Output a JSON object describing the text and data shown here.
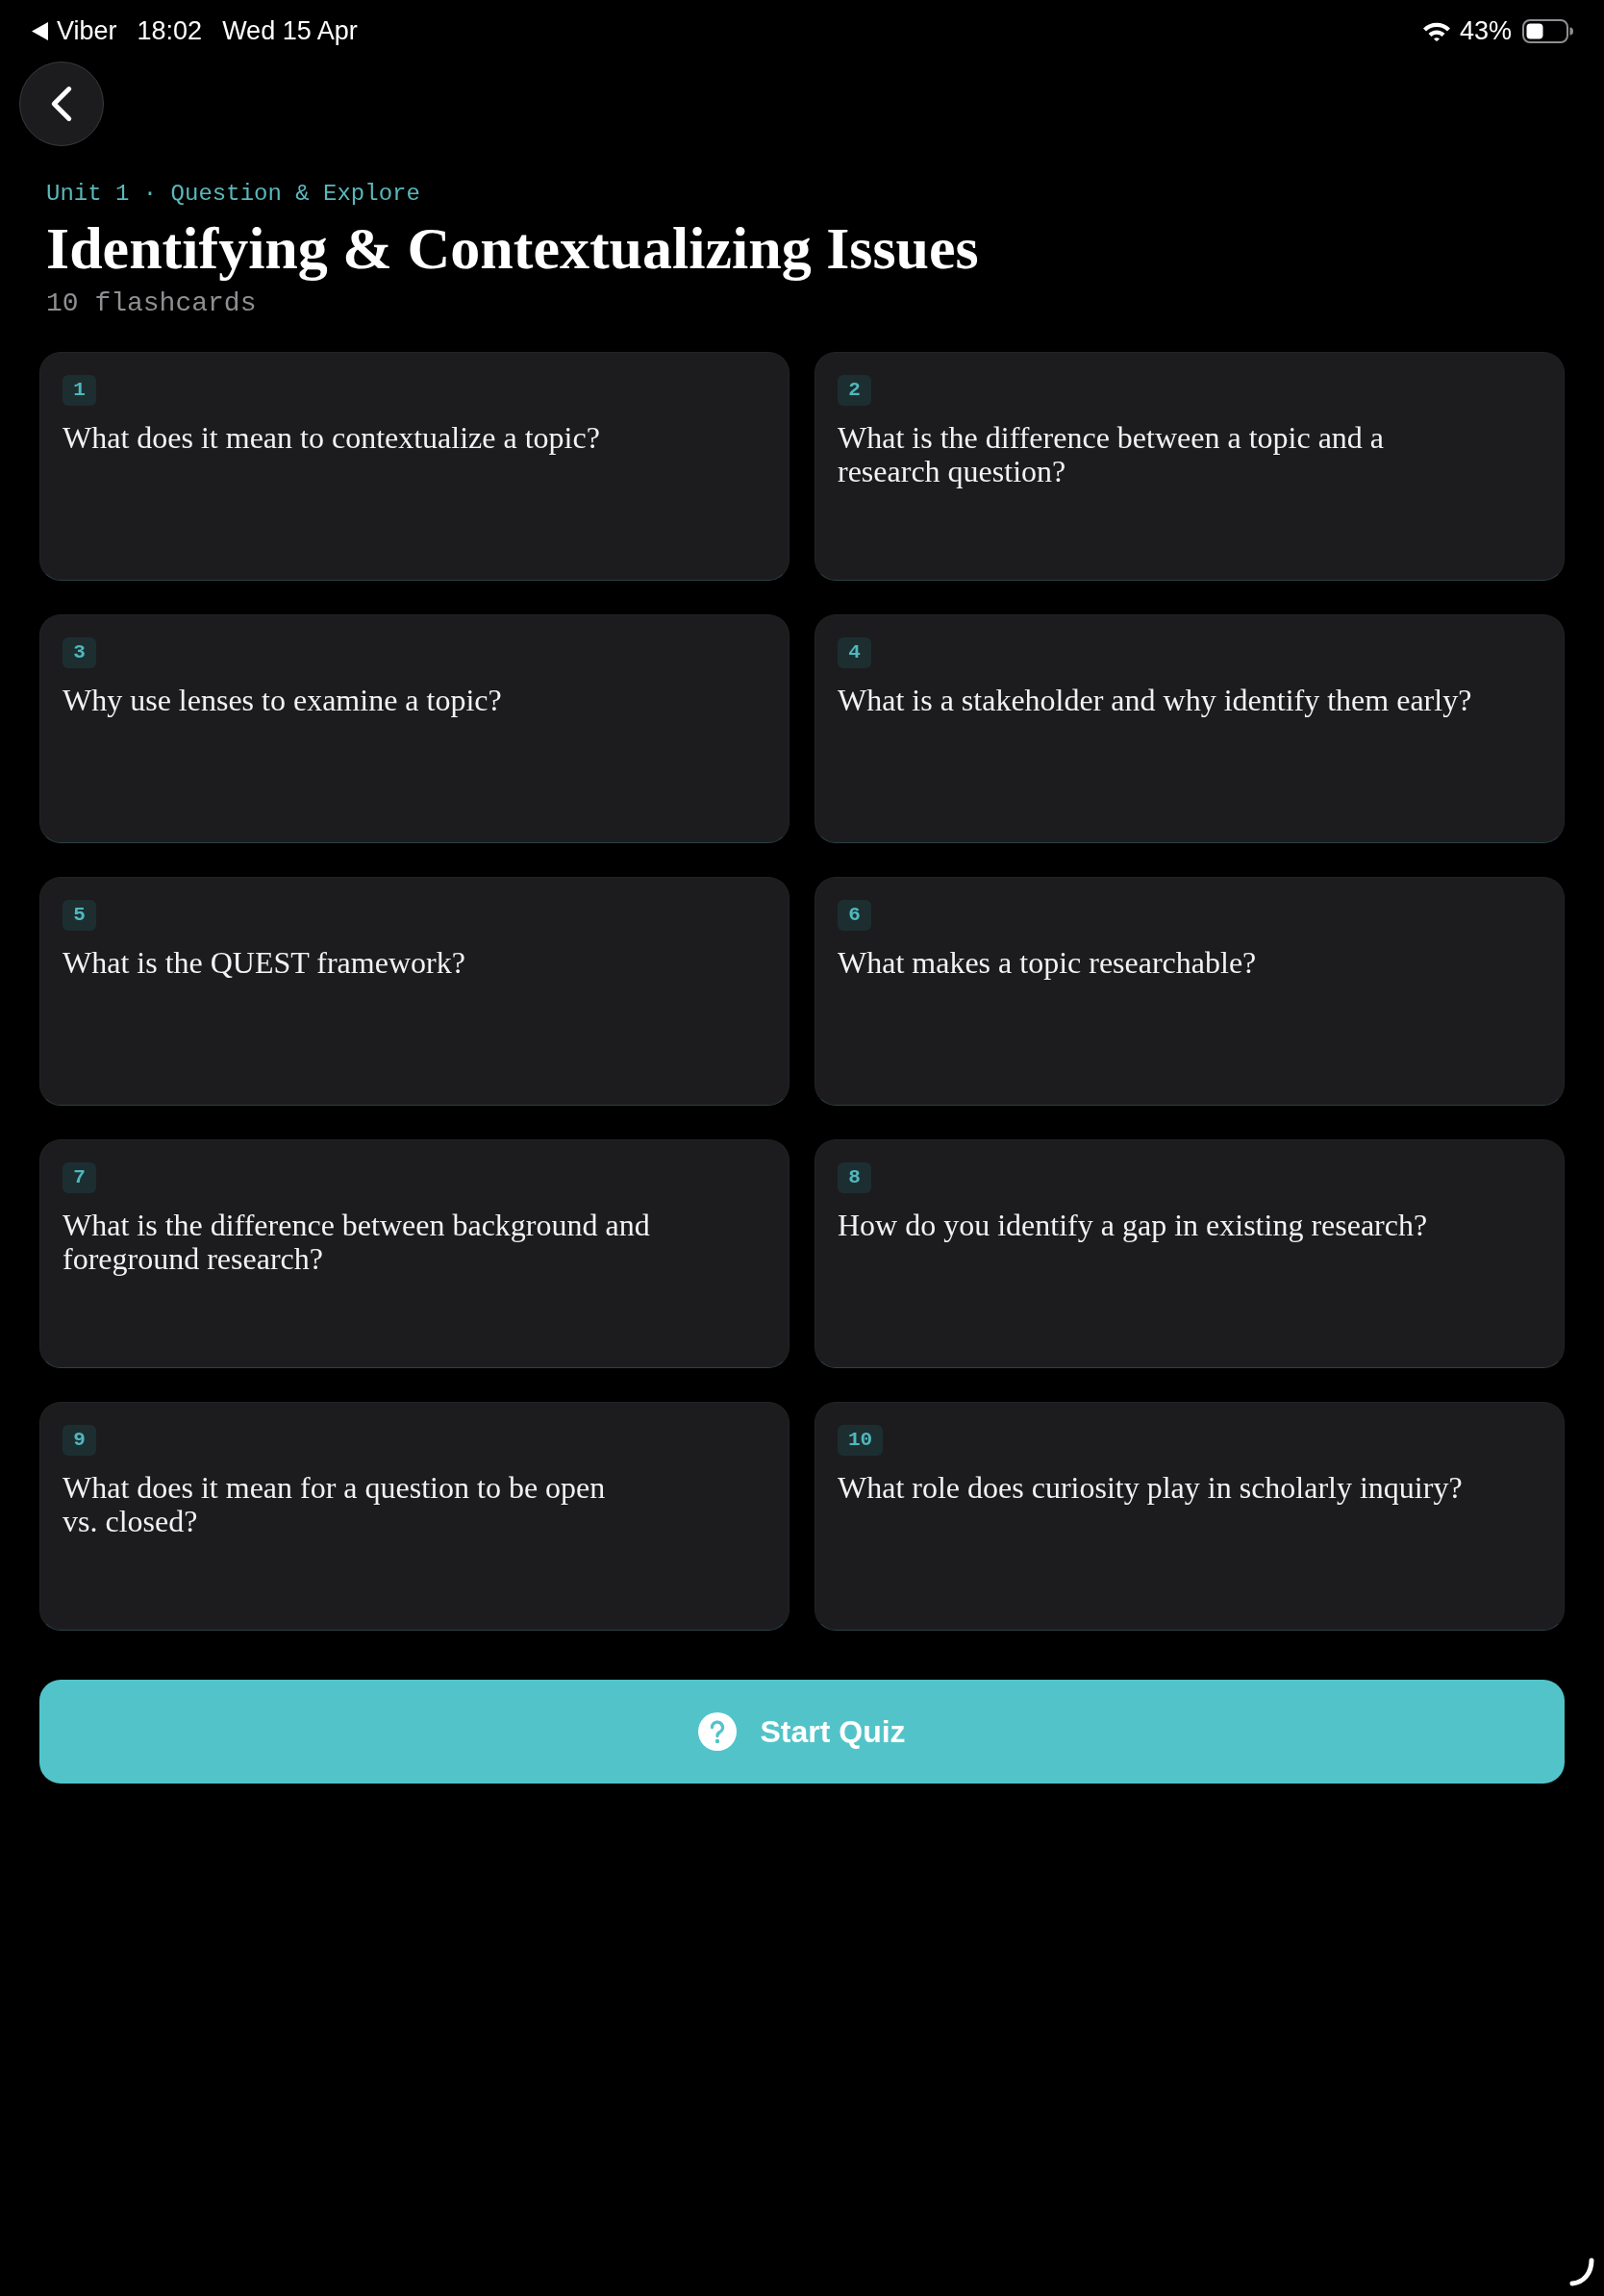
{
  "status_bar": {
    "back_app": "Viber",
    "time": "18:02",
    "date": "Wed 15 Apr",
    "battery": "43%"
  },
  "header": {
    "breadcrumb": "Unit 1 · Question & Explore",
    "title": "Identifying & Contextualizing Issues",
    "count": "10 flashcards"
  },
  "flashcards": [
    {
      "number": "1",
      "question": "What does it mean to contextualize a topic?"
    },
    {
      "number": "2",
      "question": "What is the difference between a topic and a research question?"
    },
    {
      "number": "3",
      "question": "Why use lenses to examine a topic?"
    },
    {
      "number": "4",
      "question": "What is a stakeholder and why identify them early?"
    },
    {
      "number": "5",
      "question": "What is the QUEST framework?"
    },
    {
      "number": "6",
      "question": "What makes a topic researchable?"
    },
    {
      "number": "7",
      "question": "What is the difference between background and foreground research?"
    },
    {
      "number": "8",
      "question": "How do you identify a gap in existing research?"
    },
    {
      "number": "9",
      "question": "What does it mean for a question to be open vs. closed?"
    },
    {
      "number": "10",
      "question": "What role does curiosity play in scholarly inquiry?"
    }
  ],
  "start_button": {
    "label": "Start Quiz"
  }
}
